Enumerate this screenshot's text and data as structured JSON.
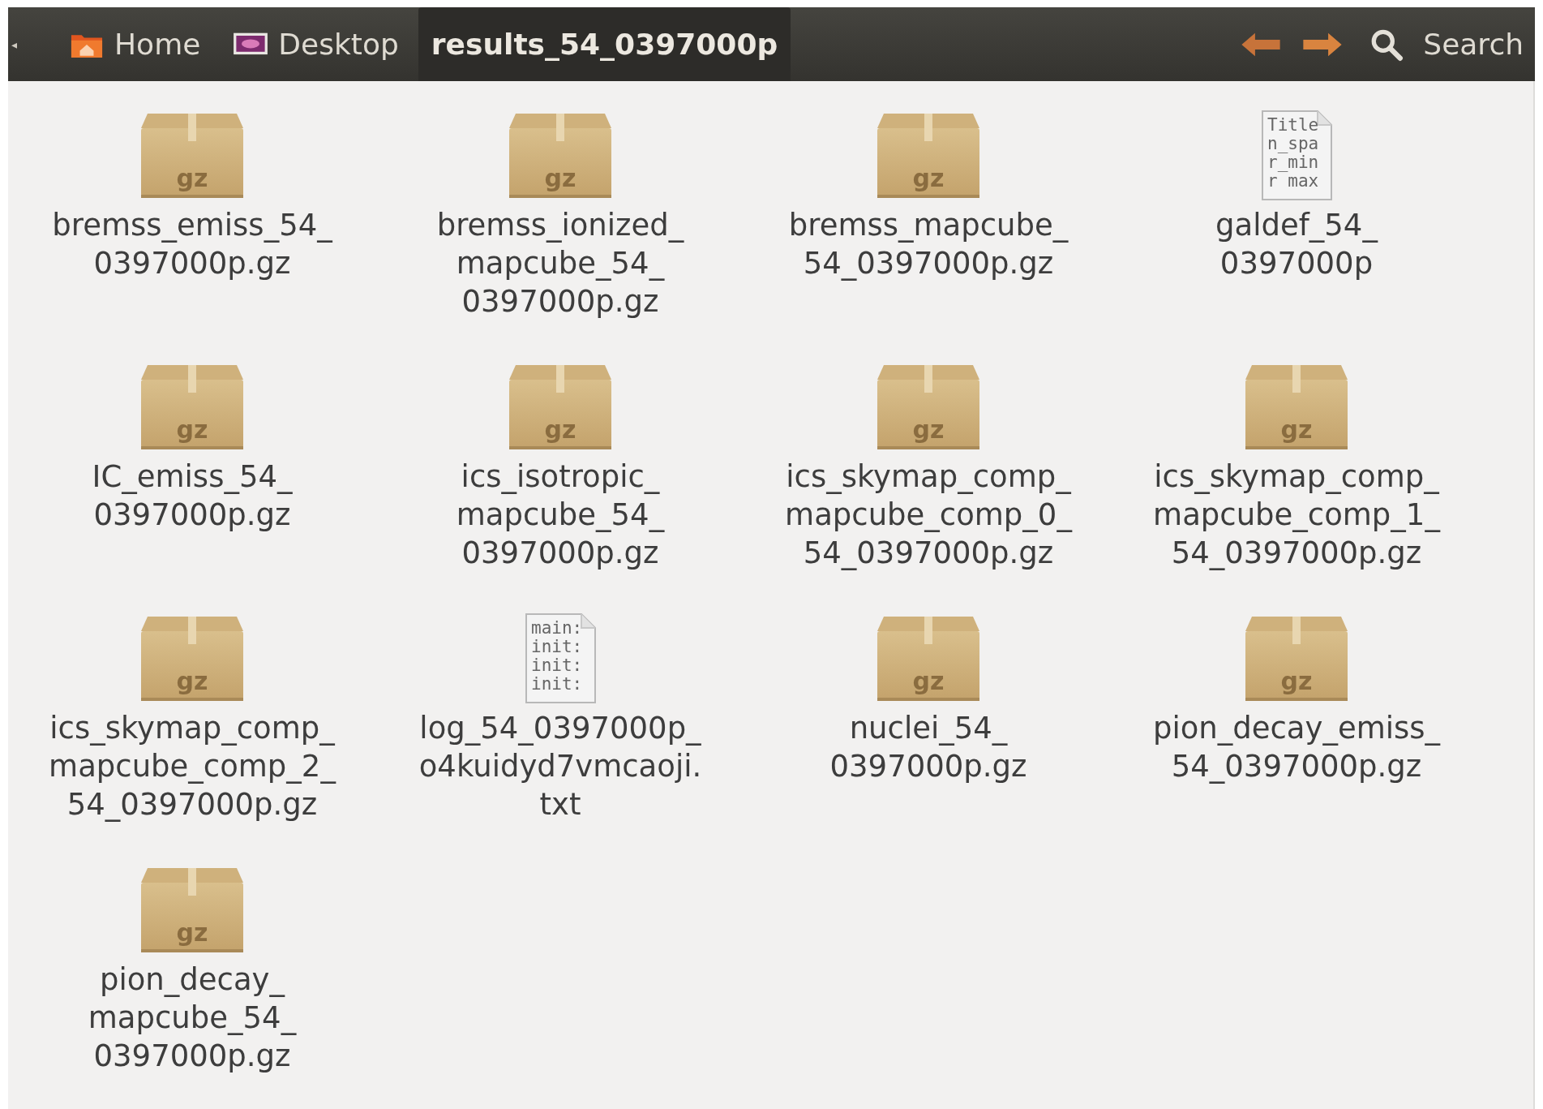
{
  "toolbar": {
    "scroll_glyph": "◂",
    "breadcrumbs": [
      {
        "label": "Home",
        "kind": "home",
        "selected": false
      },
      {
        "label": "Desktop",
        "kind": "desktop",
        "selected": false
      },
      {
        "label": "results_54_0397000p",
        "kind": "folder",
        "selected": true
      }
    ],
    "search": {
      "label": "Search"
    }
  },
  "files": [
    {
      "kind": "archive",
      "badge": "gz",
      "name_lines": [
        "bremss_emiss_54_",
        "0397000p.gz"
      ]
    },
    {
      "kind": "archive",
      "badge": "gz",
      "name_lines": [
        "bremss_ionized_",
        "mapcube_54_",
        "0397000p.gz"
      ]
    },
    {
      "kind": "archive",
      "badge": "gz",
      "name_lines": [
        "bremss_mapcube_",
        "54_0397000p.gz"
      ]
    },
    {
      "kind": "text",
      "preview": [
        "Title",
        "n_spa",
        "r_min",
        "r max"
      ],
      "name_lines": [
        "galdef_54_",
        "0397000p"
      ]
    },
    {
      "kind": "archive",
      "badge": "gz",
      "name_lines": [
        "IC_emiss_54_",
        "0397000p.gz"
      ]
    },
    {
      "kind": "archive",
      "badge": "gz",
      "name_lines": [
        "ics_isotropic_",
        "mapcube_54_",
        "0397000p.gz"
      ]
    },
    {
      "kind": "archive",
      "badge": "gz",
      "name_lines": [
        "ics_skymap_comp_",
        "mapcube_comp_0_",
        "54_0397000p.gz"
      ]
    },
    {
      "kind": "archive",
      "badge": "gz",
      "name_lines": [
        "ics_skymap_comp_",
        "mapcube_comp_1_",
        "54_0397000p.gz"
      ]
    },
    {
      "kind": "archive",
      "badge": "gz",
      "name_lines": [
        "ics_skymap_comp_",
        "mapcube_comp_2_",
        "54_0397000p.gz"
      ]
    },
    {
      "kind": "text",
      "preview": [
        "main:",
        "init:",
        "init:",
        "init:"
      ],
      "name_lines": [
        "log_54_0397000p_",
        "o4kuidyd7vmcaoji.",
        "txt"
      ]
    },
    {
      "kind": "archive",
      "badge": "gz",
      "name_lines": [
        "nuclei_54_",
        "0397000p.gz"
      ]
    },
    {
      "kind": "archive",
      "badge": "gz",
      "name_lines": [
        "pion_decay_emiss_",
        "54_0397000p.gz"
      ]
    },
    {
      "kind": "archive",
      "badge": "gz",
      "name_lines": [
        "pion_decay_",
        "mapcube_54_",
        "0397000p.gz"
      ]
    }
  ]
}
